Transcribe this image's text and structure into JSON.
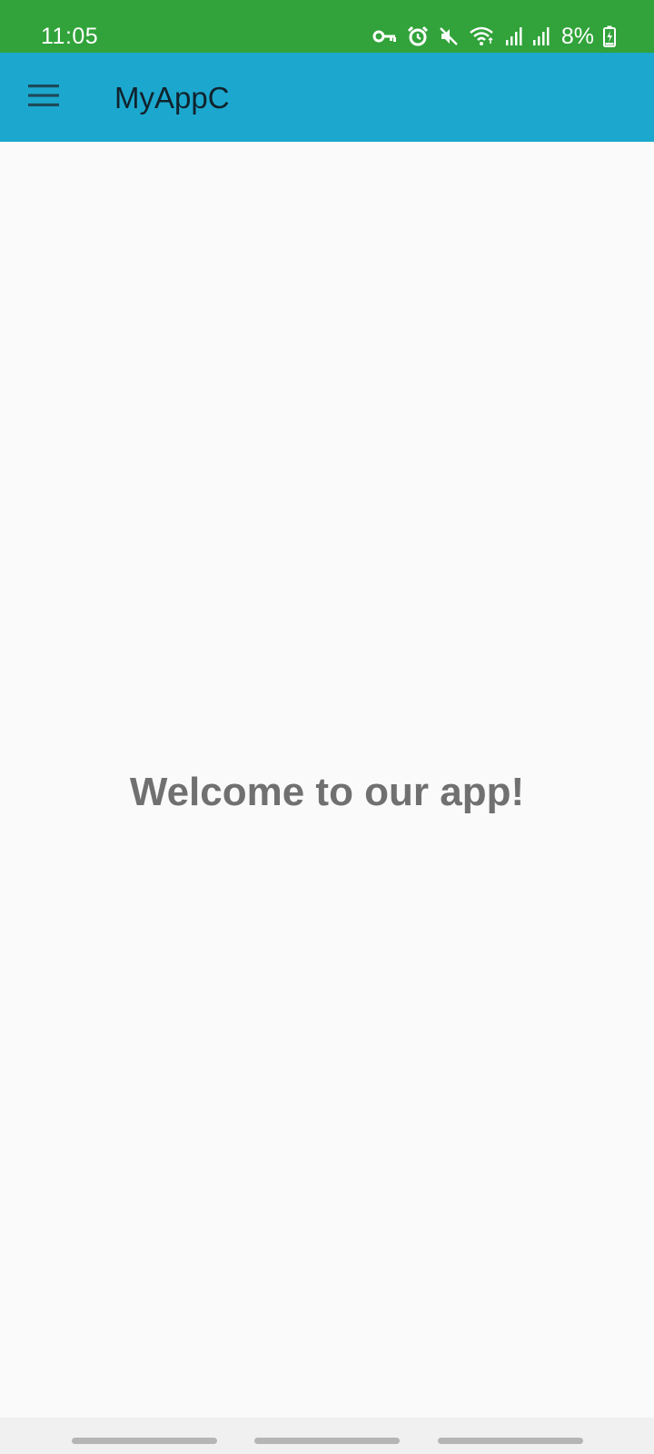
{
  "status_bar": {
    "time": "11:05",
    "battery": "8%",
    "icons": [
      "vpn-key-icon",
      "alarm-icon",
      "mute-icon",
      "wifi-icon",
      "signal-icon",
      "signal-icon",
      "battery-charging-icon"
    ],
    "background": "#31a33a"
  },
  "app_bar": {
    "title": "MyAppC",
    "menu_icon": "hamburger-menu-icon",
    "background": "#1ca8ce"
  },
  "main": {
    "welcome_text": "Welcome to our app!"
  },
  "nav_bar": {
    "handles": [
      "recent-apps",
      "home",
      "back"
    ]
  }
}
